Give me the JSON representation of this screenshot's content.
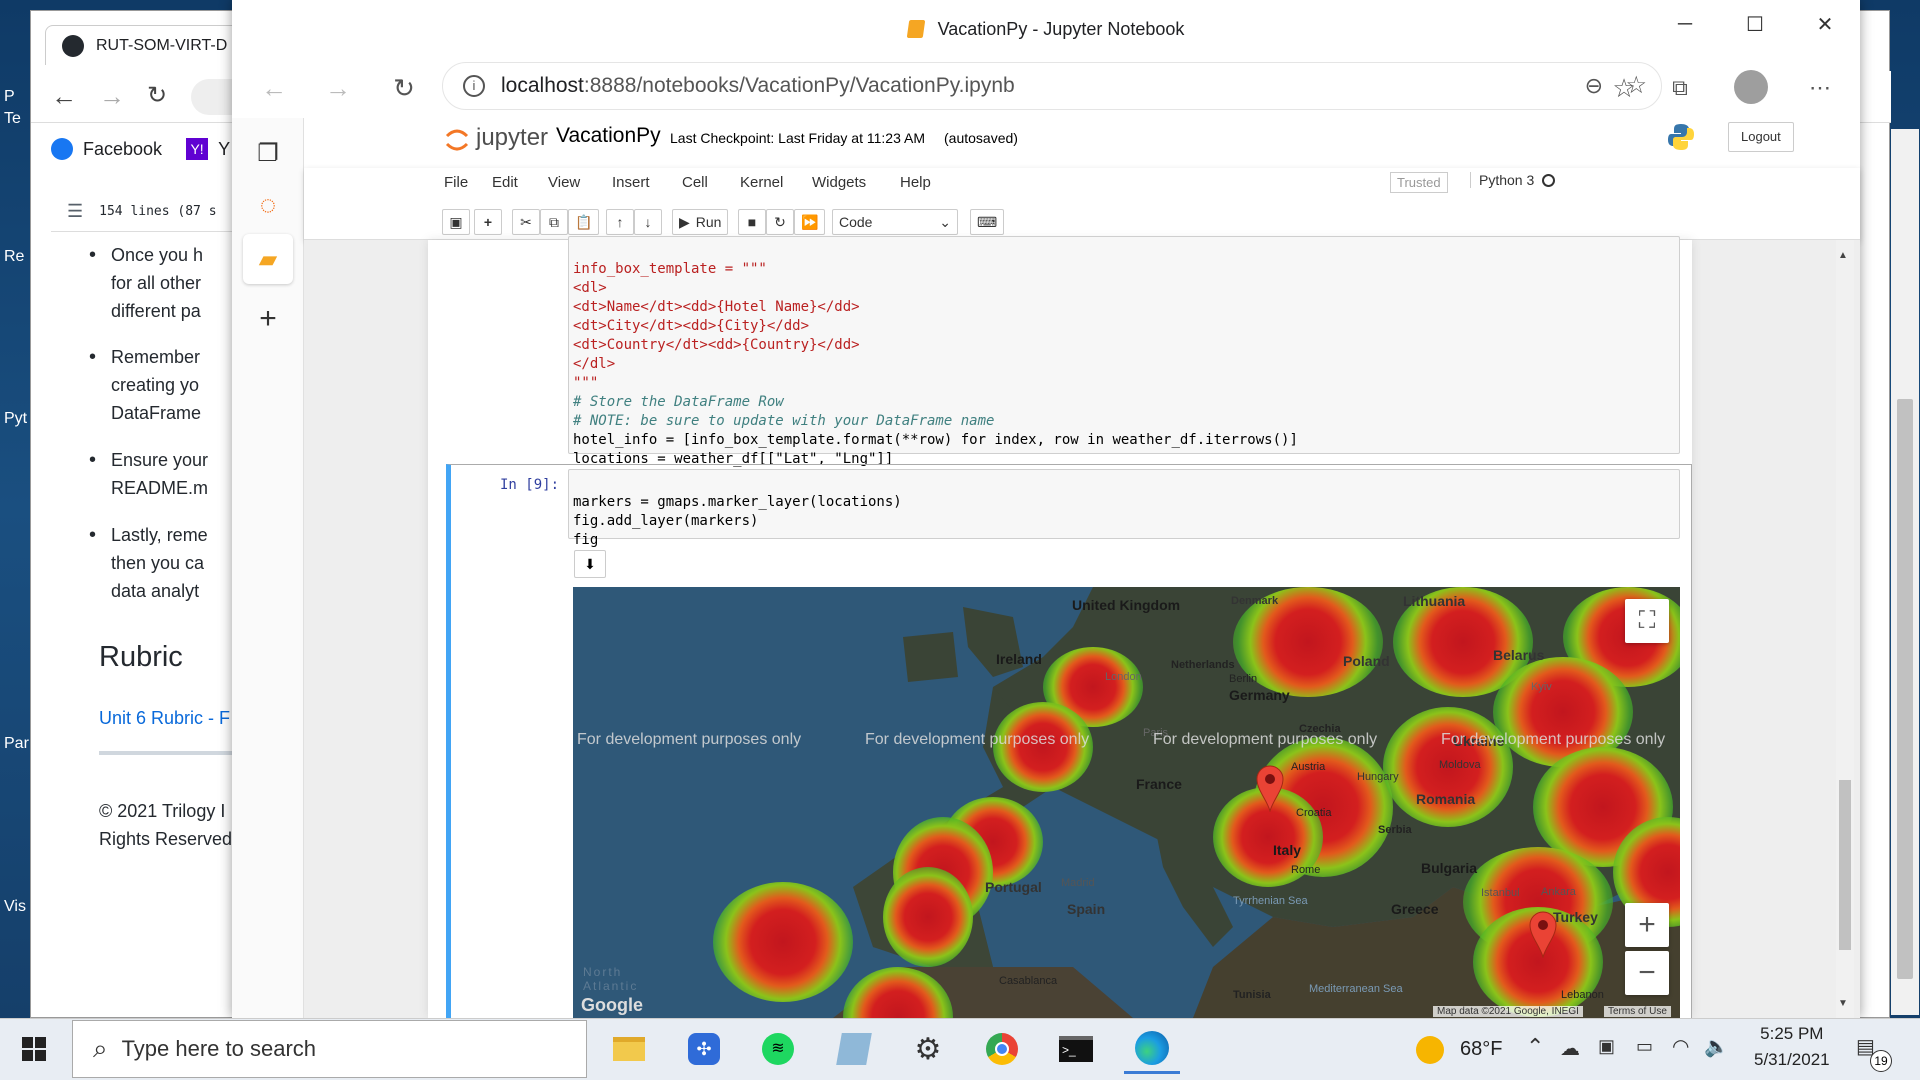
{
  "desktop": {
    "icons": [
      "P",
      "Te",
      "Re",
      "Pyt",
      "Par",
      "Vis"
    ]
  },
  "back_browser": {
    "tab_title": "RUT-SOM-VIRT-D",
    "bookmarks": [
      "Facebook",
      "Y"
    ],
    "outline_lines": "154 lines (87 s",
    "bullets": [
      [
        "Once you h",
        "for all other",
        "different pa"
      ],
      [
        "Remember",
        "creating yo",
        "DataFrame"
      ],
      [
        "Ensure your",
        "README.m"
      ],
      [
        "Lastly, reme",
        "then you ca",
        "data analyt"
      ]
    ],
    "rubric_heading": "Rubric",
    "rubric_link": "Unit 6 Rubric - F",
    "footer": [
      "© 2021 Trilogy I",
      "Rights Reserved"
    ]
  },
  "window": {
    "title": "VacationPy - Jupyter Notebook",
    "url_host": "localhost",
    "url_path": ":8888/notebooks/VacationPy/VacationPy.ipynb"
  },
  "jupyter": {
    "logo_text": "jupyter",
    "notebook_name": "VacationPy",
    "checkpoint": "Last Checkpoint: Last Friday at 11:23 AM",
    "autosaved": "(autosaved)",
    "logout": "Logout",
    "menu": [
      "File",
      "Edit",
      "View",
      "Insert",
      "Cell",
      "Kernel",
      "Widgets",
      "Help"
    ],
    "trusted": "Trusted",
    "kernel": "Python 3",
    "run_label": "Run",
    "cell_type": "Code"
  },
  "cells": {
    "cell1_lines": [
      "info_box_template = \"\"\"",
      "<dl>",
      "<dt>Name</dt><dd>{Hotel Name}</dd>",
      "<dt>City</dt><dd>{City}</dd>",
      "<dt>Country</dt><dd>{Country}</dd>",
      "</dl>",
      "\"\"\"",
      "# Store the DataFrame Row",
      "# NOTE: be sure to update with your DataFrame name",
      "hotel_info = [info_box_template.format(**row) for index, row in weather_df.iterrows()]",
      "locations = weather_df[[\"Lat\", \"Lng\"]]"
    ],
    "cell2_prompt": "In [9]:",
    "cell2_lines": [
      "markers = gmaps.marker_layer(locations)",
      "fig.add_layer(markers)",
      "fig"
    ]
  },
  "map": {
    "dev_text": "For development purposes only",
    "countries": [
      "United Kingdom",
      "Ireland",
      "Denmark",
      "Lithuania",
      "Belarus",
      "Poland",
      "Netherlands",
      "Germany",
      "Czechia",
      "France",
      "Austria",
      "Hungary",
      "Romania",
      "Moldova",
      "Ukraine",
      "Croatia",
      "Serbia",
      "Italy",
      "Bulgaria",
      "Portugal",
      "Spain",
      "Greece",
      "Turkey",
      "Tunisia",
      "Lebanon"
    ],
    "cities": [
      "London",
      "Berlin",
      "Paris",
      "Rome",
      "Madrid",
      "Istanbul",
      "Ankara",
      "Kyiv"
    ],
    "seas": [
      "Tyrrhenian Sea",
      "Mediterranean Sea",
      "North Atlantic"
    ],
    "casablanca": "Casablanca",
    "attribution": "Map data ©2021 Google, INEGI",
    "terms": "Terms of Use",
    "google": "Google",
    "zoom_in": "+",
    "zoom_out": "−"
  },
  "taskbar": {
    "search_placeholder": "Type here to search",
    "weather": "68°F",
    "time": "5:25 PM",
    "date": "5/31/2021",
    "notifications": "19"
  },
  "colors": {
    "jupyter_orange": "#f37726",
    "prompt_blue": "#303f9f",
    "selected_cell": "#42a5f5",
    "map_water": "#2f5878"
  }
}
